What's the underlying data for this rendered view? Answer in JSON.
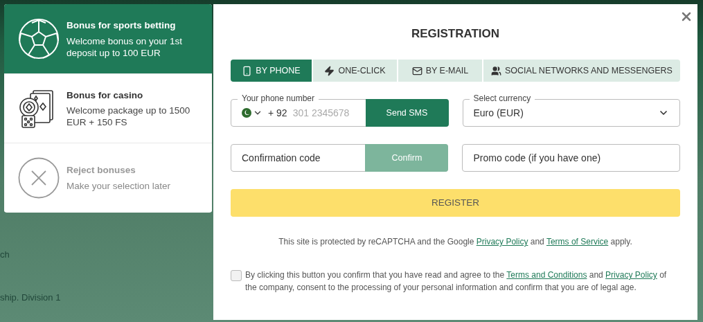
{
  "background_texts": [
    "ch",
    "ship. Division 1"
  ],
  "bonuses": [
    {
      "kind": "sports",
      "title": "Bonus for sports betting",
      "text": "Welcome bonus on your 1st deposit up to 100 EUR",
      "selected": true
    },
    {
      "kind": "casino",
      "title": "Bonus for casino",
      "text": "Welcome package up to 1500 EUR + 150 FS",
      "selected": false
    },
    {
      "kind": "reject",
      "title": "Reject bonuses",
      "text": "Make your selection later",
      "selected": false
    }
  ],
  "modal": {
    "title": "REGISTRATION",
    "tabs": [
      {
        "kind": "phone",
        "label": "BY PHONE",
        "selected": true
      },
      {
        "kind": "bolt",
        "label": "ONE-CLICK",
        "selected": false
      },
      {
        "kind": "mail",
        "label": "BY E-MAIL",
        "selected": false
      },
      {
        "kind": "people",
        "label": "SOCIAL NETWORKS AND MESSENGERS",
        "selected": false
      }
    ],
    "phone": {
      "label": "Your phone number",
      "prefix": "+ 92",
      "placeholder": "301 2345678",
      "button": "Send SMS"
    },
    "currency": {
      "label": "Select currency",
      "value": "Euro (EUR)"
    },
    "confirmation": {
      "placeholder": "Confirmation code",
      "button": "Confirm",
      "disabled": true
    },
    "promo": {
      "placeholder": "Promo code (if you have one)"
    },
    "register": "REGISTER",
    "recaptcha": [
      {
        "kind": "text",
        "text": "This site is protected by reCAPTCHA and the Google "
      },
      {
        "kind": "link",
        "text": "Privacy Policy"
      },
      {
        "kind": "text",
        "text": " and "
      },
      {
        "kind": "link",
        "text": "Terms of Service"
      },
      {
        "kind": "text",
        "text": " apply."
      }
    ],
    "agreement": {
      "checked": false,
      "parts": [
        {
          "kind": "text",
          "text": "By clicking this button you confirm that you have read and agree to the "
        },
        {
          "kind": "link",
          "text": "Terms and Conditions"
        },
        {
          "kind": "text",
          "text": " and "
        },
        {
          "kind": "link",
          "text": "Privacy Policy"
        },
        {
          "kind": "text",
          "text": " of the company, consent to the processing of your personal information and confirm that you are of legal age."
        }
      ]
    }
  }
}
